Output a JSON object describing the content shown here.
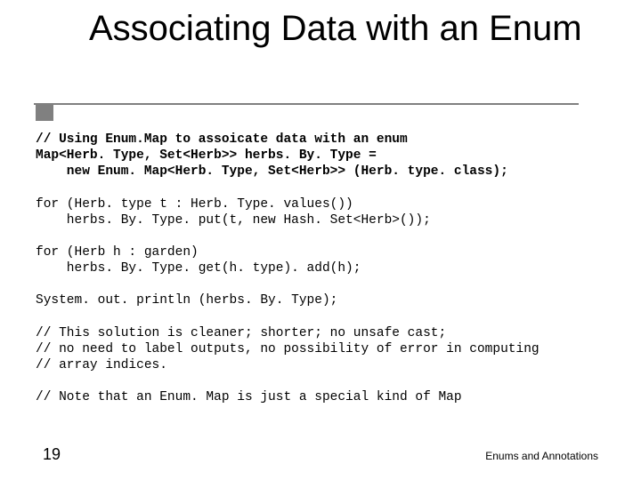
{
  "title": "Associating Data with an Enum",
  "code": {
    "l1": "// Using Enum.Map to assoicate data with an enum",
    "l2": "Map<Herb. Type, Set<Herb>> herbs. By. Type =",
    "l3": "    new Enum. Map<Herb. Type, Set<Herb>> (Herb. type. class);",
    "l4": "",
    "l5": "for (Herb. type t : Herb. Type. values())",
    "l6": "    herbs. By. Type. put(t, new Hash. Set<Herb>());",
    "l7": "",
    "l8": "for (Herb h : garden)",
    "l9": "    herbs. By. Type. get(h. type). add(h);",
    "l10": "",
    "l11": "System. out. println (herbs. By. Type);",
    "l12": "",
    "l13": "// This solution is cleaner; shorter; no unsafe cast;",
    "l14": "// no need to label outputs, no possibility of error in computing",
    "l15": "// array indices.",
    "l16": "",
    "l17": "// Note that an Enum. Map is just a special kind of Map"
  },
  "page_number": "19",
  "footer_right": "Enums and Annotations"
}
